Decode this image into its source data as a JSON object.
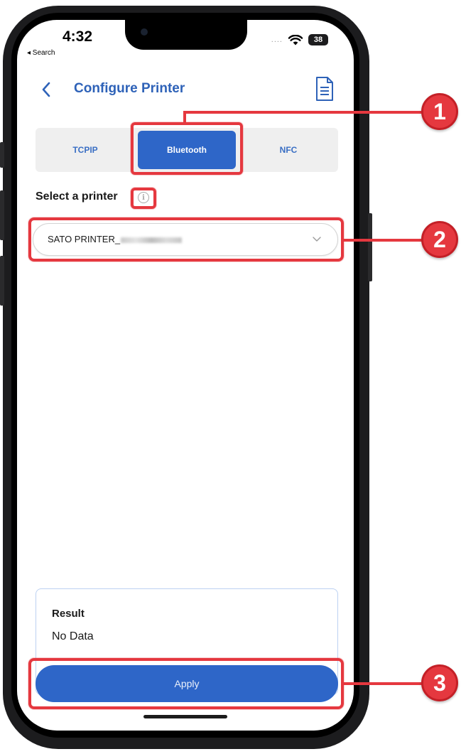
{
  "status_bar": {
    "time": "4:32",
    "back_label": "◂ Search",
    "signal": "....",
    "battery": "38"
  },
  "header": {
    "title": "Configure Printer",
    "back_icon": "chevron-left-icon",
    "doc_icon": "document-icon"
  },
  "tabs": [
    {
      "label": "TCPIP",
      "active": false
    },
    {
      "label": "Bluetooth",
      "active": true
    },
    {
      "label": "NFC",
      "active": false
    }
  ],
  "printer_select": {
    "label": "Select a printer",
    "info_icon": "i",
    "selected_value": "SATO PRINTER_"
  },
  "result": {
    "title": "Result",
    "value": "No Data"
  },
  "apply_button": {
    "label": "Apply"
  },
  "callouts": {
    "one": "1",
    "two": "2",
    "three": "3"
  },
  "colors": {
    "accent": "#2e66c8",
    "title_blue": "#2e62b8",
    "highlight_red": "#e5383f"
  }
}
